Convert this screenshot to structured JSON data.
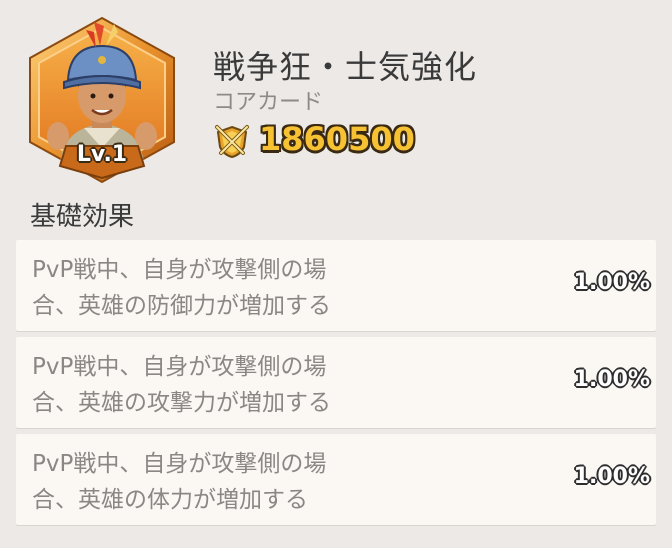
{
  "card": {
    "title": "戦争狂・士気強化",
    "subtitle": "コアカード",
    "level": "Lv.1",
    "power_value": "1860500",
    "power_icon": "crossed-swords-shield-icon",
    "colors": {
      "frame": "#e0892a",
      "frame_inner": "#f6b14a",
      "power_text": "#f6c233"
    }
  },
  "section": {
    "title": "基礎効果"
  },
  "effects": [
    {
      "line1": "PvP戦中、自身が攻撃側の場",
      "line2": "合、英雄の防御力が増加する",
      "value": "1.00%"
    },
    {
      "line1": "PvP戦中、自身が攻撃側の場",
      "line2": "合、英雄の攻撃力が増加する",
      "value": "1.00%"
    },
    {
      "line1": "PvP戦中、自身が攻撃側の場",
      "line2": "合、英雄の体力が増加する",
      "value": "1.00%"
    }
  ]
}
